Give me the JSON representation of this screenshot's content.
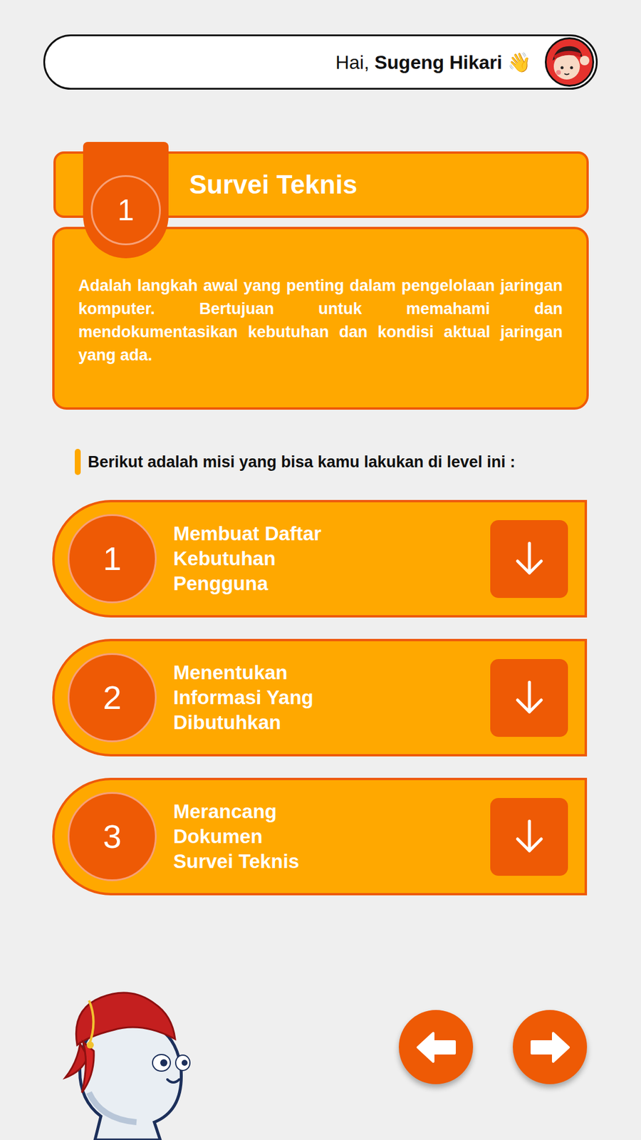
{
  "header": {
    "greeting": "Hai,",
    "name": "Sugeng Hikari",
    "wave": "👋"
  },
  "level": {
    "number": "1",
    "title": "Survei Teknis",
    "description": "Adalah langkah awal yang penting dalam pengelolaan jaringan komputer. Bertujuan untuk memahami dan mendokumentasikan kebutuhan dan kondisi aktual jaringan yang ada."
  },
  "missions_heading": "Berikut adalah misi yang bisa kamu lakukan di level ini :",
  "missions": [
    {
      "number": "1",
      "title": "Membuat Daftar Kebutuhan Pengguna"
    },
    {
      "number": "2",
      "title": "Menentukan Informasi Yang Dibutuhkan"
    },
    {
      "number": "3",
      "title": "Merancang Dokumen Survei Teknis"
    }
  ]
}
